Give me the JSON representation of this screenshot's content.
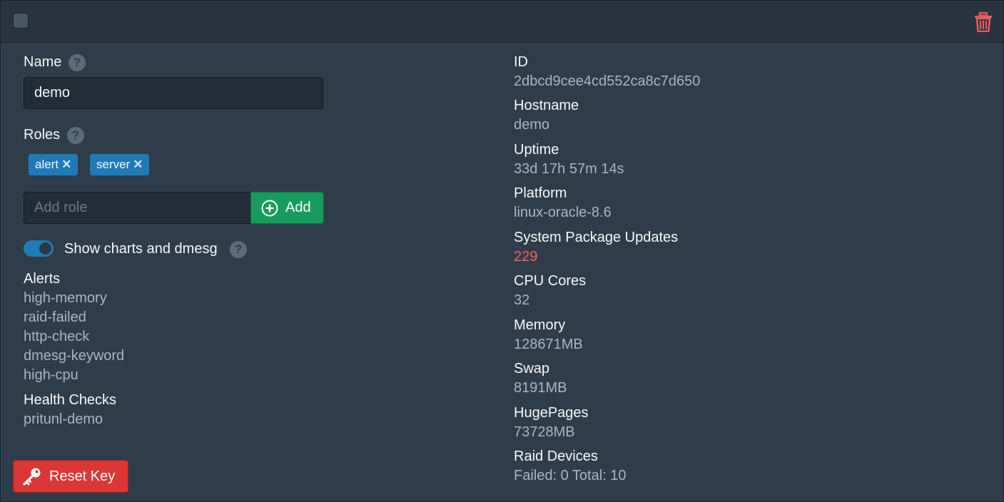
{
  "header": {
    "select_icon": "checkbox",
    "delete_icon": "trash-icon",
    "delete_color": "#e85c5c"
  },
  "form": {
    "name_label": "Name",
    "name_value": "demo",
    "roles_label": "Roles",
    "roles": [
      {
        "label": "alert",
        "remove": "✕"
      },
      {
        "label": "server",
        "remove": "✕"
      }
    ],
    "add_role_placeholder": "Add role",
    "add_button": "Add",
    "show_charts_label": "Show charts and dmesg",
    "show_charts_enabled": true,
    "help_glyph": "?",
    "alerts_label": "Alerts",
    "alerts": [
      "high-memory",
      "raid-failed",
      "http-check",
      "dmesg-keyword",
      "high-cpu"
    ],
    "health_label": "Health Checks",
    "health_checks": [
      "pritunl-demo"
    ],
    "reset_button": "Reset Key"
  },
  "info": {
    "id_label": "ID",
    "id_value": "2dbcd9cee4cd552ca8c7d650",
    "hostname_label": "Hostname",
    "hostname_value": "demo",
    "uptime_label": "Uptime",
    "uptime_value": "33d 17h 57m 14s",
    "platform_label": "Platform",
    "platform_value": "linux-oracle-8.6",
    "updates_label": "System Package Updates",
    "updates_value": "229",
    "cpu_label": "CPU Cores",
    "cpu_value": "32",
    "memory_label": "Memory",
    "memory_value": "128671MB",
    "swap_label": "Swap",
    "swap_value": "8191MB",
    "hugepages_label": "HugePages",
    "hugepages_value": "73728MB",
    "raid_label": "Raid Devices",
    "raid_value": "Failed: 0 Total: 10"
  },
  "colors": {
    "accent": "#1f7ab8",
    "success": "#169c5c",
    "danger": "#db3737",
    "warning_value": "#ff5c5c"
  }
}
